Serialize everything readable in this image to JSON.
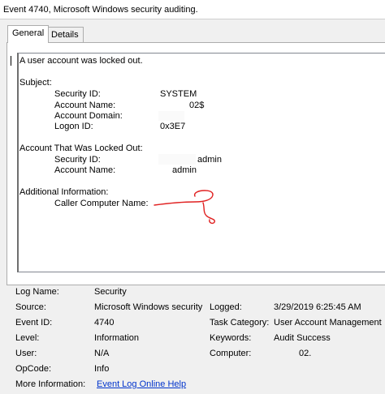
{
  "window": {
    "title": "Event 4740, Microsoft Windows security auditing."
  },
  "tabs": [
    {
      "label": "General"
    },
    {
      "label": "Details"
    }
  ],
  "message": {
    "intro": "A user account was locked out.",
    "subject": {
      "heading": "Subject:",
      "security_id_label": "Security ID:",
      "security_id_value": "SYSTEM",
      "account_name_label": "Account Name:",
      "account_name_value": "02$",
      "account_domain_label": "Account Domain:",
      "logon_id_label": "Logon ID:",
      "logon_id_value": "0x3E7"
    },
    "locked_out": {
      "heading": "Account That Was Locked Out:",
      "security_id_label": "Security ID:",
      "security_id_value": "admin",
      "account_name_label": "Account Name:",
      "account_name_value": "admin"
    },
    "additional": {
      "heading": "Additional Information:",
      "caller_label": "Caller Computer Name:"
    }
  },
  "details": {
    "log_name": {
      "label": "Log Name:",
      "value": "Security"
    },
    "source": {
      "label": "Source:",
      "value": "Microsoft Windows security"
    },
    "logged": {
      "label": "Logged:",
      "value": "3/29/2019 6:25:45 AM"
    },
    "event_id": {
      "label": "Event ID:",
      "value": "4740"
    },
    "task_category": {
      "label": "Task Category:",
      "value": "User Account Management"
    },
    "level": {
      "label": "Level:",
      "value": "Information"
    },
    "keywords": {
      "label": "Keywords:",
      "value": "Audit Success"
    },
    "user": {
      "label": "User:",
      "value": "N/A"
    },
    "computer": {
      "label": "Computer:",
      "value": "02."
    },
    "opcode": {
      "label": "OpCode:",
      "value": "Info"
    },
    "more_info": {
      "label": "More Information:",
      "link": "Event Log Online Help"
    }
  },
  "annotation_color": "#e02020"
}
